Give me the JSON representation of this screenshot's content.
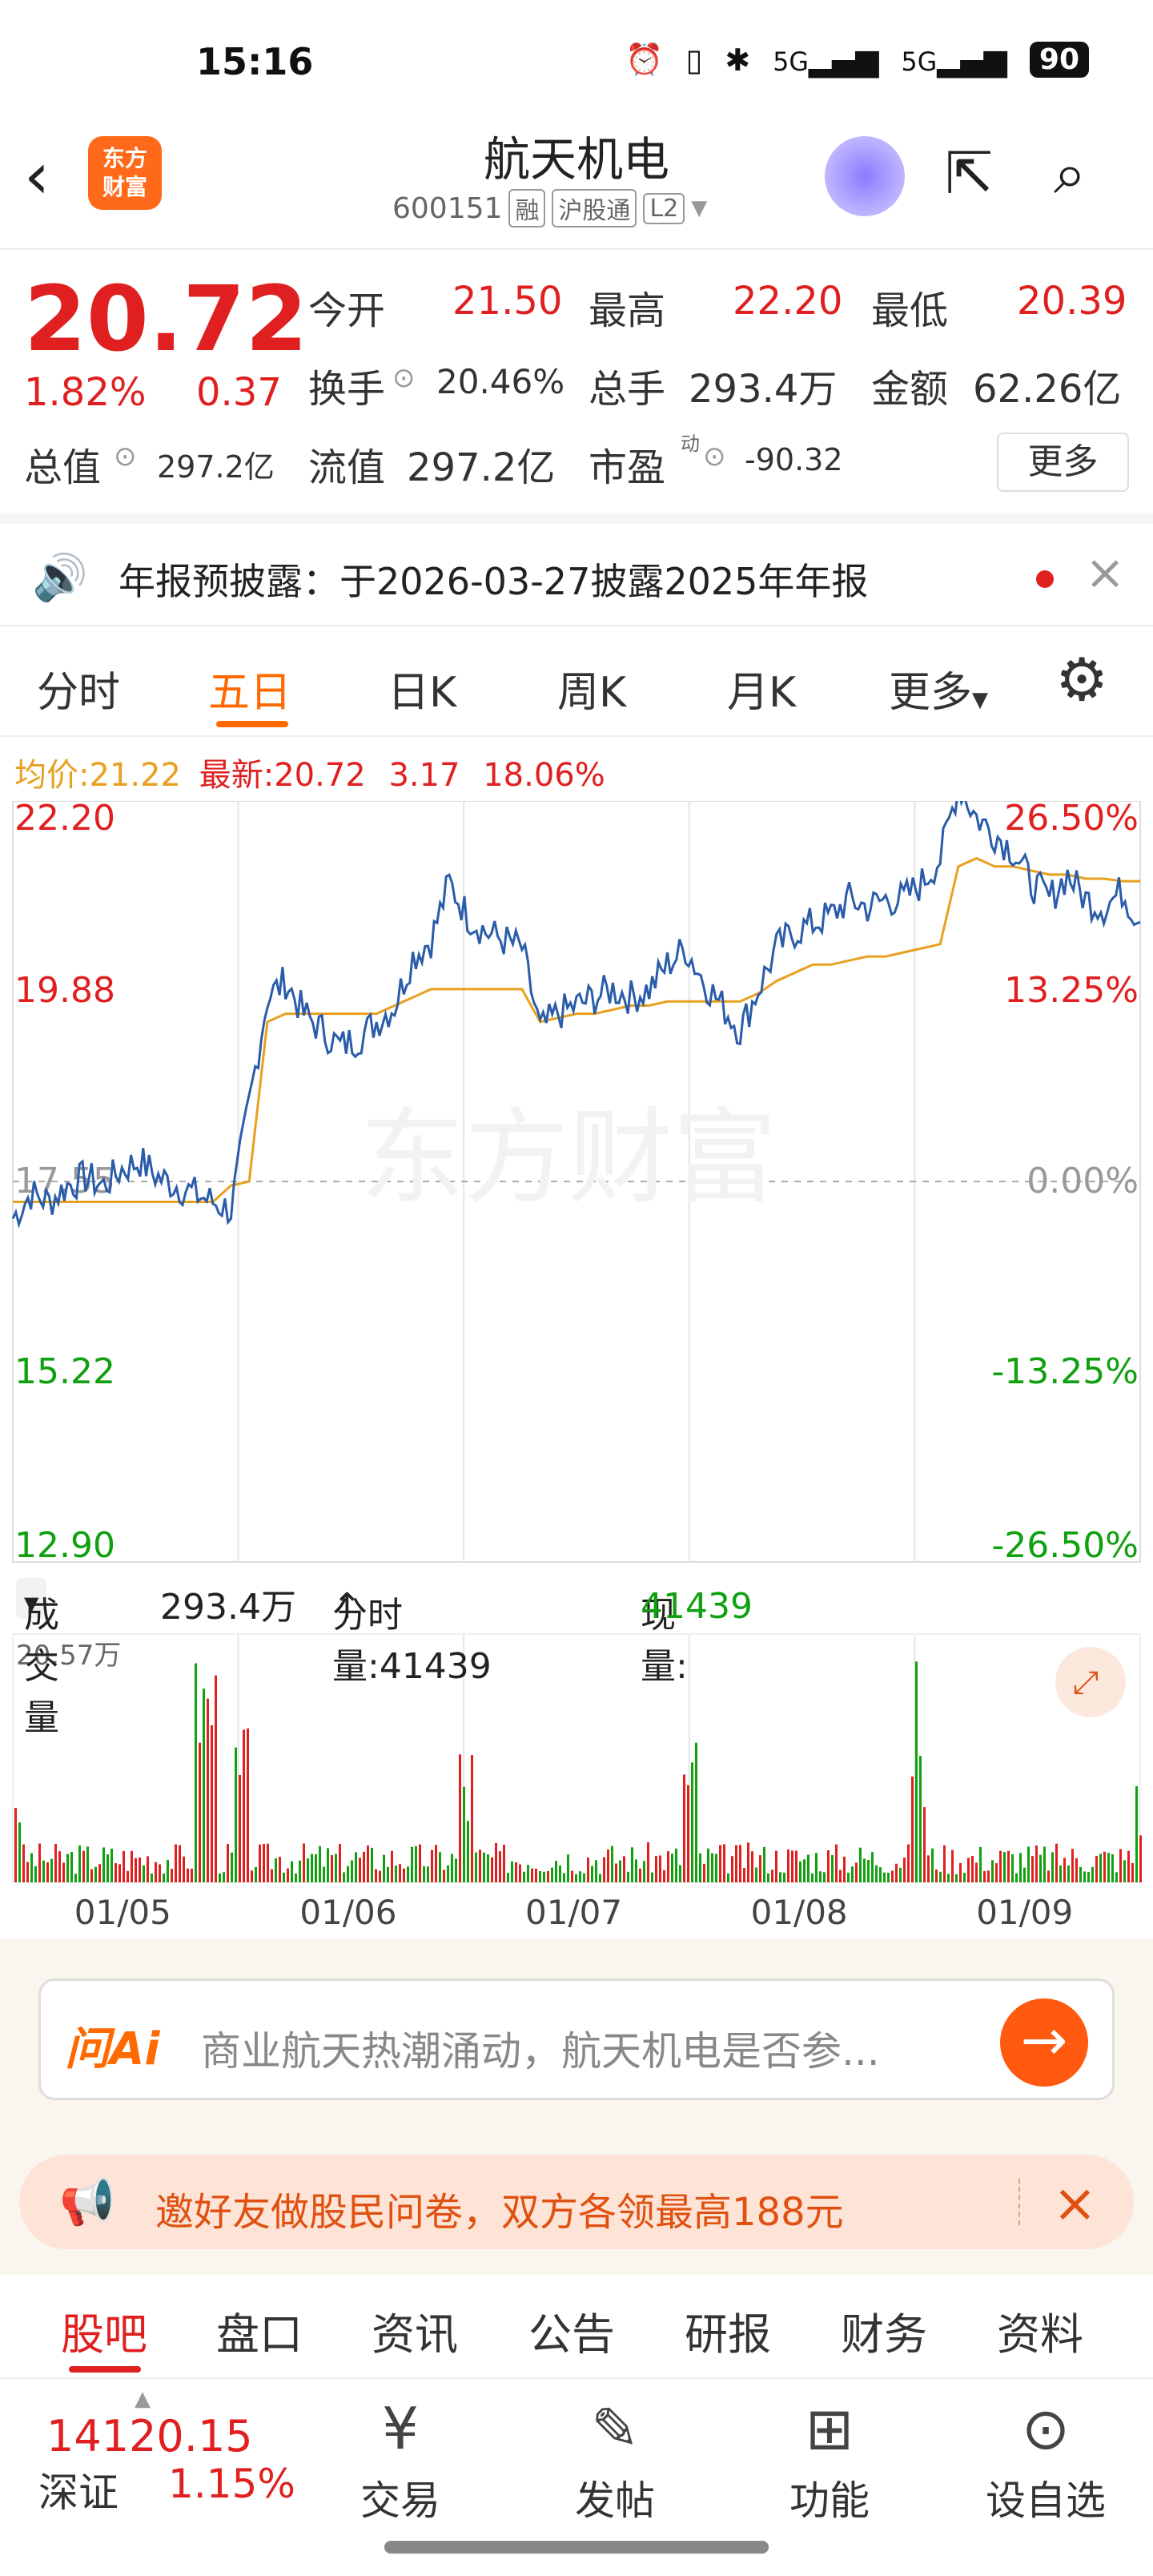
{
  "status": {
    "time": "15:16",
    "battery": "90",
    "net1": "5G",
    "net2": "5G"
  },
  "header": {
    "title": "航天机电",
    "code": "600151",
    "tags": [
      "融",
      "沪股通",
      "L2"
    ],
    "logo_line1": "东方",
    "logo_line2": "财富"
  },
  "quote": {
    "price": "20.72",
    "change_pct": "1.82%",
    "change": "0.37",
    "open_label": "今开",
    "open": "21.50",
    "high_label": "最高",
    "high": "22.20",
    "low_label": "最低",
    "low": "20.39",
    "turnover_label": "换手",
    "turnover": "20.46%",
    "volume_label": "总手",
    "volume": "293.4万",
    "amount_label": "金额",
    "amount": "62.26亿",
    "mktcap_label": "总值",
    "mktcap": "297.2亿",
    "float_label": "流值",
    "float": "297.2亿",
    "pe_label": "市盈",
    "pe_sup": "动",
    "pe": "-90.32",
    "more": "更多"
  },
  "notice": {
    "text": "年报预披露：于2026-03-27披露2025年年报"
  },
  "tabs": [
    "分时",
    "五日",
    "日K",
    "周K",
    "月K",
    "更多"
  ],
  "avg": {
    "avg_label": "均价:",
    "avg": "21.22",
    "latest_label": "最新:",
    "latest": "20.72",
    "chg": "3.17",
    "pct": "18.06%"
  },
  "chart_data": {
    "type": "line",
    "y_left": [
      "22.20",
      "19.88",
      "17.55",
      "15.22",
      "12.90"
    ],
    "y_right": [
      "26.50%",
      "13.25%",
      "0.00%",
      "-13.25%",
      "-26.50%"
    ],
    "ylim": [
      12.9,
      22.2
    ],
    "prev_close": 17.55,
    "x": [
      "01/05",
      "01/06",
      "01/07",
      "01/08",
      "01/09"
    ],
    "series": [
      {
        "values": [
          17.1,
          17.4,
          17.3,
          17.5,
          17.6,
          17.5,
          17.7,
          17.8,
          17.6,
          17.5,
          17.4,
          17.3,
          17.2,
          18.5,
          19.8,
          20.0,
          19.6,
          19.4,
          19.2,
          19.3,
          19.5,
          19.7,
          20.3,
          20.5,
          21.2,
          20.8,
          20.6,
          20.5,
          20.4,
          19.4,
          19.6,
          19.7,
          19.8,
          19.9,
          19.8,
          19.9,
          20.2,
          20.4,
          20.0,
          19.7,
          19.4,
          19.9,
          20.4,
          20.6,
          20.7,
          20.8,
          21.0,
          20.9,
          21.0,
          21.0,
          21.2,
          21.5,
          22.4,
          22.0,
          21.8,
          21.6,
          21.2,
          21.0,
          21.3,
          21.0,
          20.9,
          21.1,
          20.72
        ]
      },
      {
        "values": [
          17.3,
          17.3,
          17.3,
          17.3,
          17.3,
          17.3,
          17.3,
          17.3,
          17.3,
          17.3,
          17.3,
          17.3,
          17.5,
          17.55,
          19.5,
          19.6,
          19.6,
          19.6,
          19.6,
          19.6,
          19.6,
          19.7,
          19.8,
          19.9,
          19.9,
          19.9,
          19.9,
          19.9,
          19.9,
          19.5,
          19.55,
          19.6,
          19.6,
          19.65,
          19.7,
          19.7,
          19.75,
          19.75,
          19.75,
          19.75,
          19.75,
          19.85,
          20.0,
          20.1,
          20.2,
          20.2,
          20.25,
          20.3,
          20.3,
          20.35,
          20.4,
          20.45,
          21.4,
          21.5,
          21.4,
          21.4,
          21.35,
          21.3,
          21.3,
          21.25,
          21.25,
          21.22,
          21.22
        ]
      }
    ],
    "volume_max": "20.57万"
  },
  "volume": {
    "label": "成交量",
    "total": "293.4万",
    "tick_label": "分时量:41439",
    "tick_arrow": "↑",
    "now_label": "现量:",
    "now": "41439"
  },
  "ask": {
    "ai": "问Ai",
    "placeholder": "商业航天热潮涌动，航天机电是否参..."
  },
  "promo": {
    "text": "邀好友做股民问卷，双方各领最高188元"
  },
  "btabs": [
    "股吧",
    "盘口",
    "资讯",
    "公告",
    "研报",
    "财务",
    "资料"
  ],
  "bottom": {
    "index": "14120.15",
    "index_name": "深证",
    "index_pct": "1.15%",
    "nav": [
      "交易",
      "发帖",
      "功能",
      "设自选"
    ]
  },
  "colors": {
    "up": "#e02020",
    "down": "#10a010",
    "accent": "#ff6a00",
    "line": "#2a5caa",
    "avg": "#e8a020"
  }
}
